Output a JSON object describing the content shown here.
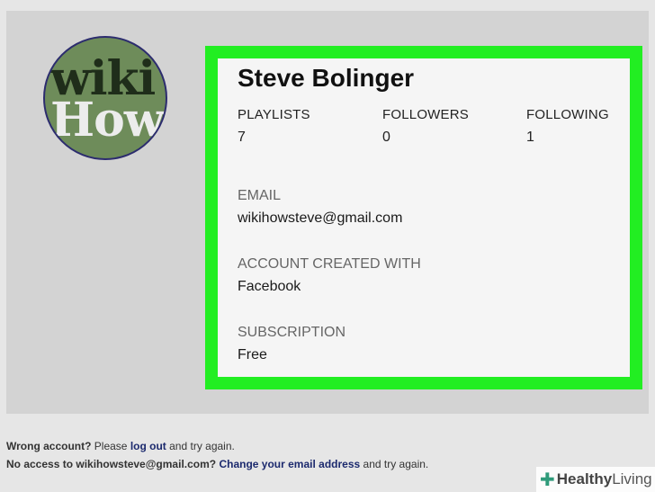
{
  "avatar": {
    "line1": "wiki",
    "line2": "How"
  },
  "profile": {
    "name": "Steve Bolinger",
    "stats": [
      {
        "label": "PLAYLISTS",
        "value": "7"
      },
      {
        "label": "FOLLOWERS",
        "value": "0"
      },
      {
        "label": "FOLLOWING",
        "value": "1"
      }
    ],
    "fields": [
      {
        "label": "EMAIL",
        "value": "wikihowsteve@gmail.com"
      },
      {
        "label": "ACCOUNT CREATED WITH",
        "value": "Facebook"
      },
      {
        "label": "SUBSCRIPTION",
        "value": "Free"
      }
    ]
  },
  "footer": {
    "line1_bold": "Wrong account?",
    "line1_mid": " Please ",
    "line1_link": "log out",
    "line1_end": " and try again.",
    "line2_bold": "No access to wikihowsteve@gmail.com?",
    "line2_link": "Change your email address",
    "line2_end": " and try again."
  },
  "watermark": {
    "bold": "Healthy",
    "rest": "Living"
  },
  "colors": {
    "highlight": "#22ee22",
    "link": "#1c2a6e",
    "avatar_bg": "#6e8c5a"
  }
}
